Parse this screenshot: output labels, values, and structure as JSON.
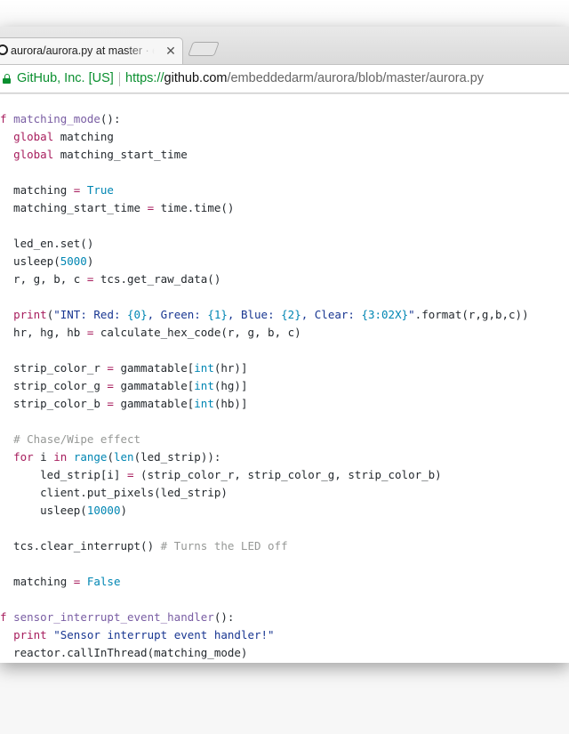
{
  "tab": {
    "title": "aurora/aurora.py at master · embeddedarm/aurora",
    "favicon": "github-icon",
    "close_glyph": "✕"
  },
  "omnibox": {
    "site_identity": "GitHub, Inc. [US]",
    "url_scheme": "https://",
    "url_host": "github.com",
    "url_path": "/embeddedarm/aurora/blob/master/aurora.py",
    "secure_color": "#0a8f2f"
  },
  "code": {
    "language": "python",
    "lines": [
      "f matching_mode():",
      "  global matching",
      "  global matching_start_time",
      "",
      "  matching = True",
      "  matching_start_time = time.time()",
      "",
      "  led_en.set()",
      "  usleep(5000)",
      "  r, g, b, c = tcs.get_raw_data()",
      "",
      "  print(\"INT: Red: {0}, Green: {1}, Blue: {2}, Clear: {3:02X}\".format(r,g,b,c))",
      "  hr, hg, hb = calculate_hex_code(r, g, b, c)",
      "",
      "  strip_color_r = gammatable[int(hr)]",
      "  strip_color_g = gammatable[int(hg)]",
      "  strip_color_b = gammatable[int(hb)]",
      "",
      "  # Chase/Wipe effect",
      "  for i in range(len(led_strip)):",
      "      led_strip[i] = (strip_color_r, strip_color_g, strip_color_b)",
      "      client.put_pixels(led_strip)",
      "      usleep(10000)",
      "",
      "  tcs.clear_interrupt() # Turns the LED off",
      "",
      "  matching = False",
      "",
      "f sensor_interrupt_event_handler():",
      "  print \"Sensor interrupt event handler!\"",
      "  reactor.callInThread(matching_mode)"
    ]
  }
}
